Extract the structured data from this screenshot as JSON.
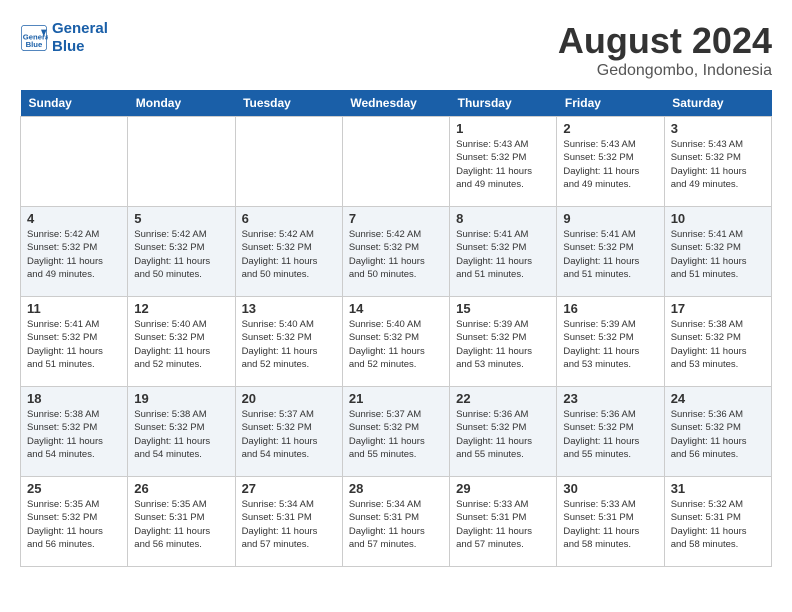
{
  "header": {
    "logo_line1": "General",
    "logo_line2": "Blue",
    "month_year": "August 2024",
    "location": "Gedongombo, Indonesia"
  },
  "days_of_week": [
    "Sunday",
    "Monday",
    "Tuesday",
    "Wednesday",
    "Thursday",
    "Friday",
    "Saturday"
  ],
  "weeks": [
    [
      {
        "day": "",
        "info": ""
      },
      {
        "day": "",
        "info": ""
      },
      {
        "day": "",
        "info": ""
      },
      {
        "day": "",
        "info": ""
      },
      {
        "day": "1",
        "info": "Sunrise: 5:43 AM\nSunset: 5:32 PM\nDaylight: 11 hours\nand 49 minutes."
      },
      {
        "day": "2",
        "info": "Sunrise: 5:43 AM\nSunset: 5:32 PM\nDaylight: 11 hours\nand 49 minutes."
      },
      {
        "day": "3",
        "info": "Sunrise: 5:43 AM\nSunset: 5:32 PM\nDaylight: 11 hours\nand 49 minutes."
      }
    ],
    [
      {
        "day": "4",
        "info": "Sunrise: 5:42 AM\nSunset: 5:32 PM\nDaylight: 11 hours\nand 49 minutes."
      },
      {
        "day": "5",
        "info": "Sunrise: 5:42 AM\nSunset: 5:32 PM\nDaylight: 11 hours\nand 50 minutes."
      },
      {
        "day": "6",
        "info": "Sunrise: 5:42 AM\nSunset: 5:32 PM\nDaylight: 11 hours\nand 50 minutes."
      },
      {
        "day": "7",
        "info": "Sunrise: 5:42 AM\nSunset: 5:32 PM\nDaylight: 11 hours\nand 50 minutes."
      },
      {
        "day": "8",
        "info": "Sunrise: 5:41 AM\nSunset: 5:32 PM\nDaylight: 11 hours\nand 51 minutes."
      },
      {
        "day": "9",
        "info": "Sunrise: 5:41 AM\nSunset: 5:32 PM\nDaylight: 11 hours\nand 51 minutes."
      },
      {
        "day": "10",
        "info": "Sunrise: 5:41 AM\nSunset: 5:32 PM\nDaylight: 11 hours\nand 51 minutes."
      }
    ],
    [
      {
        "day": "11",
        "info": "Sunrise: 5:41 AM\nSunset: 5:32 PM\nDaylight: 11 hours\nand 51 minutes."
      },
      {
        "day": "12",
        "info": "Sunrise: 5:40 AM\nSunset: 5:32 PM\nDaylight: 11 hours\nand 52 minutes."
      },
      {
        "day": "13",
        "info": "Sunrise: 5:40 AM\nSunset: 5:32 PM\nDaylight: 11 hours\nand 52 minutes."
      },
      {
        "day": "14",
        "info": "Sunrise: 5:40 AM\nSunset: 5:32 PM\nDaylight: 11 hours\nand 52 minutes."
      },
      {
        "day": "15",
        "info": "Sunrise: 5:39 AM\nSunset: 5:32 PM\nDaylight: 11 hours\nand 53 minutes."
      },
      {
        "day": "16",
        "info": "Sunrise: 5:39 AM\nSunset: 5:32 PM\nDaylight: 11 hours\nand 53 minutes."
      },
      {
        "day": "17",
        "info": "Sunrise: 5:38 AM\nSunset: 5:32 PM\nDaylight: 11 hours\nand 53 minutes."
      }
    ],
    [
      {
        "day": "18",
        "info": "Sunrise: 5:38 AM\nSunset: 5:32 PM\nDaylight: 11 hours\nand 54 minutes."
      },
      {
        "day": "19",
        "info": "Sunrise: 5:38 AM\nSunset: 5:32 PM\nDaylight: 11 hours\nand 54 minutes."
      },
      {
        "day": "20",
        "info": "Sunrise: 5:37 AM\nSunset: 5:32 PM\nDaylight: 11 hours\nand 54 minutes."
      },
      {
        "day": "21",
        "info": "Sunrise: 5:37 AM\nSunset: 5:32 PM\nDaylight: 11 hours\nand 55 minutes."
      },
      {
        "day": "22",
        "info": "Sunrise: 5:36 AM\nSunset: 5:32 PM\nDaylight: 11 hours\nand 55 minutes."
      },
      {
        "day": "23",
        "info": "Sunrise: 5:36 AM\nSunset: 5:32 PM\nDaylight: 11 hours\nand 55 minutes."
      },
      {
        "day": "24",
        "info": "Sunrise: 5:36 AM\nSunset: 5:32 PM\nDaylight: 11 hours\nand 56 minutes."
      }
    ],
    [
      {
        "day": "25",
        "info": "Sunrise: 5:35 AM\nSunset: 5:32 PM\nDaylight: 11 hours\nand 56 minutes."
      },
      {
        "day": "26",
        "info": "Sunrise: 5:35 AM\nSunset: 5:31 PM\nDaylight: 11 hours\nand 56 minutes."
      },
      {
        "day": "27",
        "info": "Sunrise: 5:34 AM\nSunset: 5:31 PM\nDaylight: 11 hours\nand 57 minutes."
      },
      {
        "day": "28",
        "info": "Sunrise: 5:34 AM\nSunset: 5:31 PM\nDaylight: 11 hours\nand 57 minutes."
      },
      {
        "day": "29",
        "info": "Sunrise: 5:33 AM\nSunset: 5:31 PM\nDaylight: 11 hours\nand 57 minutes."
      },
      {
        "day": "30",
        "info": "Sunrise: 5:33 AM\nSunset: 5:31 PM\nDaylight: 11 hours\nand 58 minutes."
      },
      {
        "day": "31",
        "info": "Sunrise: 5:32 AM\nSunset: 5:31 PM\nDaylight: 11 hours\nand 58 minutes."
      }
    ]
  ]
}
